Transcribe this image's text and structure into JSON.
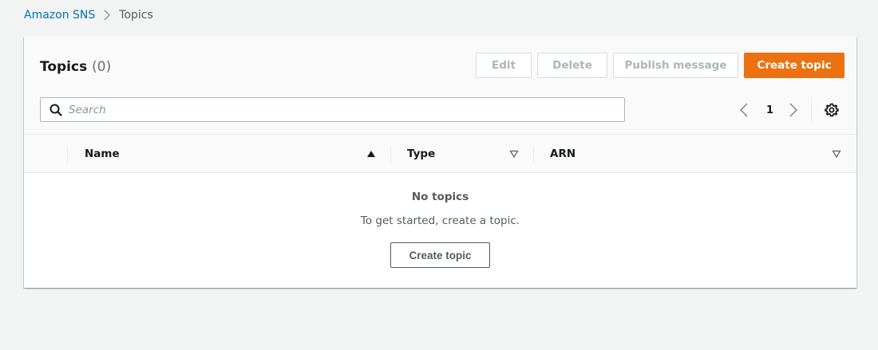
{
  "breadcrumb": {
    "root": "Amazon SNS",
    "current": "Topics"
  },
  "panel": {
    "title": "Topics",
    "count": "(0)",
    "actions": {
      "edit": "Edit",
      "delete": "Delete",
      "publish": "Publish message",
      "create": "Create topic"
    },
    "search": {
      "placeholder": "Search",
      "value": ""
    },
    "pagination": {
      "current_page": "1"
    },
    "columns": [
      {
        "label": "Name",
        "sort": "ascending"
      },
      {
        "label": "Type",
        "sort": "none"
      },
      {
        "label": "ARN",
        "sort": "none"
      }
    ],
    "empty": {
      "title": "No topics",
      "description": "To get started, create a topic.",
      "button": "Create topic"
    }
  },
  "colors": {
    "primary_button": "#ec7211",
    "link": "#0073bb",
    "disabled_text": "#aab7b8"
  },
  "icons": [
    "chevron-right-icon",
    "search-icon",
    "chevron-left-icon",
    "gear-icon",
    "sort-ascending-icon",
    "sort-descending-icon"
  ]
}
